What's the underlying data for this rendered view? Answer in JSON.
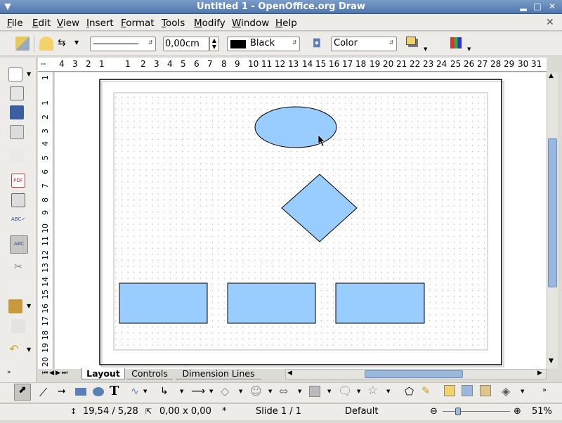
{
  "window": {
    "title": "Untitled 1 - OpenOffice.org Draw"
  },
  "menubar": {
    "items": [
      "File",
      "Edit",
      "View",
      "Insert",
      "Format",
      "Tools",
      "Modify",
      "Window",
      "Help"
    ]
  },
  "toolbar": {
    "line_width": "0,00cm",
    "line_color": "Black",
    "area_style": "Color"
  },
  "ruler": {
    "h_ticks": [
      "4",
      "3",
      "2",
      "1",
      "1",
      "2",
      "3",
      "4",
      "5",
      "6",
      "7",
      "8",
      "9",
      "10",
      "11",
      "12",
      "13",
      "14",
      "15",
      "16",
      "17",
      "18",
      "19",
      "20",
      "21",
      "22",
      "23",
      "24",
      "25",
      "26",
      "27",
      "28",
      "29",
      "30",
      "31"
    ],
    "v_ticks": [
      "1",
      "1",
      "2",
      "3",
      "4",
      "5",
      "6",
      "7",
      "8",
      "9",
      "10",
      "11",
      "12",
      "13",
      "14",
      "15",
      "16",
      "17",
      "18",
      "19",
      "20"
    ]
  },
  "tabs": {
    "layout": "Layout",
    "controls": "Controls",
    "dimension_lines": "Dimension Lines"
  },
  "status": {
    "position": "19,54 / 5,28",
    "size": "0,00 x 0,00",
    "modified": "*",
    "slide": "Slide 1 / 1",
    "layout": "Default",
    "zoom": "51%"
  },
  "colors": {
    "shape_fill": "#99ccff",
    "title_bar": "#5b80b5"
  },
  "icons": [
    "down-arrow-icon",
    "minimize-icon",
    "maximize-icon",
    "close-icon"
  ]
}
